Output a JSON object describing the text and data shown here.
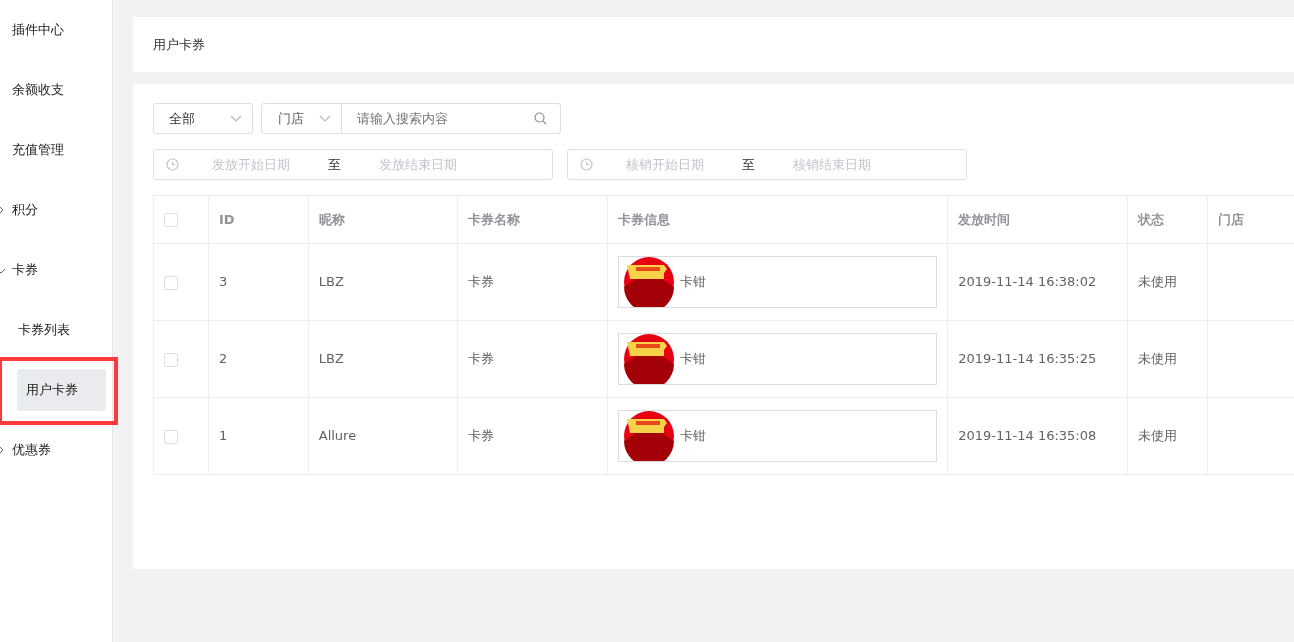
{
  "sidebar": {
    "items": [
      {
        "label": "插件中心",
        "kind": "link",
        "selected": false
      },
      {
        "label": "余额收支",
        "kind": "link",
        "selected": false
      },
      {
        "label": "充值管理",
        "kind": "link",
        "selected": false
      },
      {
        "label": "积分",
        "kind": "group",
        "expanded": false,
        "selected": false
      },
      {
        "label": "卡券",
        "kind": "group",
        "expanded": true,
        "selected": false,
        "children": [
          {
            "label": "卡券列表",
            "selected": false,
            "highlighted": false
          },
          {
            "label": "用户卡券",
            "selected": true,
            "highlighted": true
          }
        ]
      },
      {
        "label": "优惠券",
        "kind": "group",
        "expanded": false,
        "selected": false
      }
    ]
  },
  "header": {
    "title": "用户卡券"
  },
  "filters": {
    "type_select": {
      "value": "全部"
    },
    "store_select": {
      "value": "门店"
    },
    "search": {
      "placeholder": "请输入搜索内容"
    },
    "date_ranges": [
      {
        "start_placeholder": "发放开始日期",
        "separator": "至",
        "end_placeholder": "发放结束日期"
      },
      {
        "start_placeholder": "核销开始日期",
        "separator": "至",
        "end_placeholder": "核销结束日期"
      }
    ]
  },
  "table": {
    "all_checked": false,
    "columns": [
      "ID",
      "昵称",
      "卡券名称",
      "卡券信息",
      "发放时间",
      "状态",
      "门店"
    ],
    "rows": [
      {
        "checked": false,
        "id": "3",
        "nickname": "LBZ",
        "card_name": "卡券",
        "card_info": "卡钳",
        "issued_at": "2019-11-14 16:38:02",
        "status": "未使用"
      },
      {
        "checked": false,
        "id": "2",
        "nickname": "LBZ",
        "card_name": "卡券",
        "card_info": "卡钳",
        "issued_at": "2019-11-14 16:35:25",
        "status": "未使用"
      },
      {
        "checked": false,
        "id": "1",
        "nickname": "Allure",
        "card_name": "卡券",
        "card_info": "卡钳",
        "issued_at": "2019-11-14 16:35:08",
        "status": "未使用"
      }
    ]
  }
}
